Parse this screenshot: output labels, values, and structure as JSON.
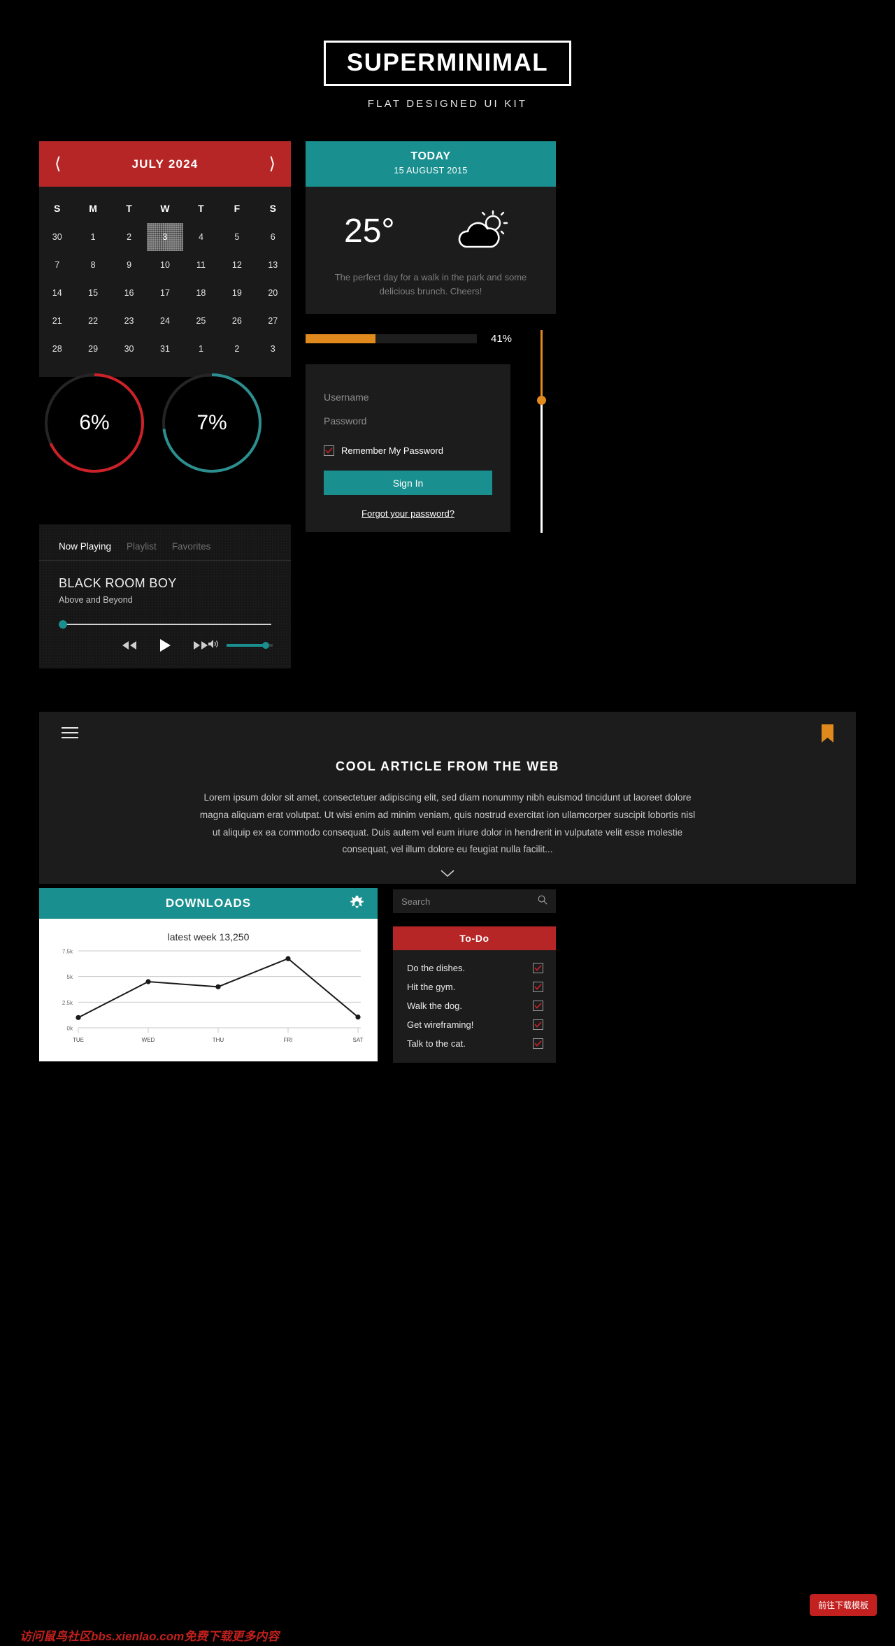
{
  "masthead": {
    "title": "SUPERMINIMAL",
    "subtitle": "FLAT DESIGNED UI KIT"
  },
  "calendar": {
    "month_label": "JULY 2024",
    "prev_icon": "chevron-left-icon",
    "next_icon": "chevron-right-icon",
    "day_headers": [
      "S",
      "M",
      "T",
      "W",
      "T",
      "F",
      "S"
    ],
    "selected_day": "3",
    "weeks": [
      [
        "30",
        "1",
        "2",
        "3",
        "4",
        "5",
        "6"
      ],
      [
        "7",
        "8",
        "9",
        "10",
        "11",
        "12",
        "13"
      ],
      [
        "14",
        "15",
        "16",
        "17",
        "18",
        "19",
        "20"
      ],
      [
        "21",
        "22",
        "23",
        "24",
        "25",
        "26",
        "27"
      ],
      [
        "28",
        "29",
        "30",
        "31",
        "1",
        "2",
        "3"
      ]
    ],
    "header_color": "#b72626"
  },
  "rings": [
    {
      "label": "6%",
      "value": 6,
      "arc_percent": 68,
      "color": "#cc2128"
    },
    {
      "label": "7%",
      "value": 7,
      "arc_percent": 73,
      "color": "#2c8f8f"
    }
  ],
  "player": {
    "tabs": [
      {
        "label": "Now Playing",
        "active": true
      },
      {
        "label": "Playlist",
        "active": false
      },
      {
        "label": "Favorites",
        "active": false
      }
    ],
    "track_title": "BLACK ROOM BOY",
    "track_artist": "Above and Beyond",
    "scrub_percent": 0,
    "volume_percent": 82,
    "prev_icon": "rewind-icon",
    "play_icon": "play-icon",
    "next_icon": "fast-forward-icon",
    "volume_icon": "speaker-icon",
    "accent_color": "#1a8f8f"
  },
  "weather": {
    "heading": "TODAY",
    "date": "15 AUGUST 2015",
    "temperature": "25°",
    "icon": "sun-behind-cloud-icon",
    "description": "The perfect day for a walk in the park and some delicious brunch. Cheers!",
    "header_color": "#1a8f8f"
  },
  "progress": {
    "percent_label": "41%",
    "percent": 41,
    "fill_color": "#e08a1e"
  },
  "vertical_slider": {
    "percent": 34,
    "fill_color": "#e08a1e"
  },
  "login": {
    "username_placeholder": "Username",
    "password_placeholder": "Password",
    "username_value": "",
    "password_value": "",
    "remember_label": "Remember My Password",
    "remember_checked": true,
    "signin_label": "Sign In",
    "forgot_label": "Forgot your password?",
    "button_color": "#1a8f8f",
    "check_color": "#cc2128"
  },
  "article": {
    "menu_icon": "hamburger-menu-icon",
    "bookmark_icon": "bookmark-icon",
    "title": "COOL ARTICLE FROM THE WEB",
    "body": "Lorem ipsum dolor sit amet, consectetuer adipiscing elit, sed diam nonummy nibh euismod tincidunt ut laoreet dolore magna aliquam erat volutpat. Ut wisi enim ad minim veniam, quis nostrud exercitat ion ullamcorper suscipit lobortis nisl ut aliquip ex ea commodo consequat. Duis autem vel eum iriure dolor in hendrerit in vulputate velit esse molestie consequat, vel illum dolore eu feugiat nulla facilit...",
    "expand_icon": "chevron-down-icon",
    "bookmark_color": "#e08a1e"
  },
  "downloads": {
    "title": "DOWNLOADS",
    "gear_icon": "gear-icon",
    "header_color": "#1a8f8f"
  },
  "chart_data": {
    "type": "line",
    "title": "latest week 13,250",
    "categories": [
      "TUE",
      "WED",
      "THU",
      "FRI",
      "SAT"
    ],
    "values": [
      1000,
      4500,
      4000,
      6750,
      1050
    ],
    "ytick_labels": [
      "0k",
      "2.5k",
      "5k",
      "7.5k"
    ],
    "ytick_values": [
      0,
      2500,
      5000,
      7500
    ],
    "ylim": [
      0,
      7500
    ],
    "xlabel": "",
    "ylabel": "",
    "grid": true,
    "legend": "none",
    "line_color": "#1a1a1a",
    "marker": "circle"
  },
  "search": {
    "placeholder": "Search",
    "value": "",
    "icon": "search-icon"
  },
  "todo": {
    "title": "To-Do",
    "header_color": "#b72626",
    "check_color": "#cc2128",
    "items": [
      {
        "label": "Do the dishes.",
        "checked": true
      },
      {
        "label": "Hit the gym.",
        "checked": true
      },
      {
        "label": "Walk the dog.",
        "checked": true
      },
      {
        "label": "Get wireframing!",
        "checked": true
      },
      {
        "label": "Talk to the cat.",
        "checked": true
      }
    ]
  },
  "watermark": {
    "button_label": "前往下载模板",
    "text": "访问鼠鸟社区bbs.xienlao.com免费下载更多内容"
  }
}
